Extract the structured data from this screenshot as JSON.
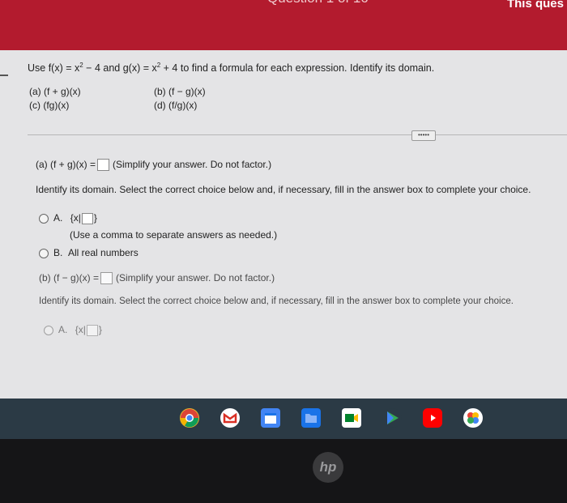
{
  "header": {
    "title": "Question 1 of 16",
    "right_text": "This ques"
  },
  "problem": {
    "prompt_parts": {
      "a": "Use f(x) = x",
      "b": "2",
      "c": " − 4 and g(x) = x",
      "d": "2",
      "e": " + 4 to find a formula for each expression. Identify its domain."
    },
    "parts": {
      "a": "(a)  (f + g)(x)",
      "b": "(b)  (f − g)(x)",
      "c": "(c)  (fg)(x)",
      "d": "(d)  (f/g)(x)"
    },
    "more_label": "•••••"
  },
  "part_a": {
    "lead": "(a) (f + g)(x) =",
    "hint": "(Simplify your answer. Do not factor.)",
    "domain_instruction": "Identify its domain. Select the correct choice below and, if necessary, fill in the answer box to complete your choice.",
    "choice_a_label": "A.",
    "choice_a_prefix": "{x|",
    "choice_a_suffix": "}",
    "choice_a_note": "(Use a comma to separate answers as needed.)",
    "choice_b_label": "B.",
    "choice_b_text": "All real numbers"
  },
  "part_b": {
    "lead": "(b) (f − g)(x) =",
    "hint": "(Simplify your answer. Do not factor.)",
    "domain_instruction": "Identify its domain. Select the correct choice below and, if necessary, fill in the answer box to complete your choice.",
    "choice_a_label": "A.",
    "choice_a_prefix": "{x|",
    "choice_a_suffix": "}"
  },
  "taskbar": {
    "icons": [
      "chrome-icon",
      "gmail-icon",
      "calendar-icon",
      "files-icon",
      "meet-icon",
      "play-store-icon",
      "youtube-icon",
      "photos-icon"
    ]
  },
  "device": {
    "logo": "hp"
  }
}
